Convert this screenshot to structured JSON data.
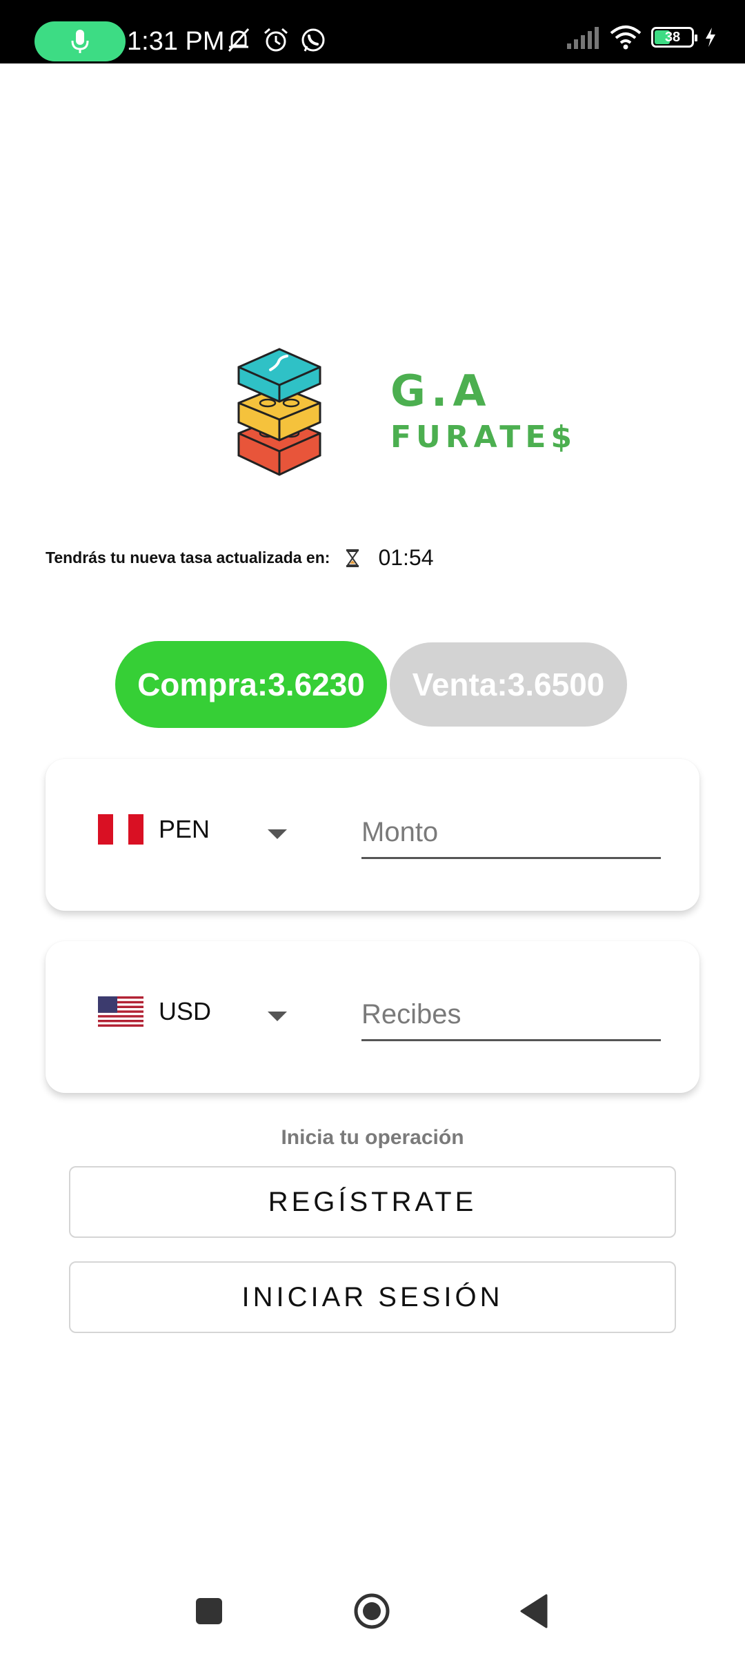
{
  "status_bar": {
    "time": "1:31 PM",
    "battery_level": "38",
    "icons": [
      "mic-icon",
      "mute-icon",
      "alarm-icon",
      "whatsapp-icon",
      "signal-icon",
      "wifi-icon",
      "battery-icon",
      "charging-icon"
    ]
  },
  "brand": {
    "title": "G.A",
    "subtitle": "FURATE$",
    "logo_icon": "stacked-blocks-icon"
  },
  "timer": {
    "label": "Tendrás tu nueva tasa actualizada en:",
    "icon": "hourglass-icon",
    "value": "01:54"
  },
  "rates": {
    "buy_label": "Compra:3.6230",
    "sell_label": "Venta:3.6500",
    "buy_color": "#36cf36",
    "sell_color": "#d3d3d3"
  },
  "from_currency": {
    "code": "PEN",
    "flag": "peru-flag-icon",
    "input_placeholder": "Monto",
    "input_value": ""
  },
  "to_currency": {
    "code": "USD",
    "flag": "usa-flag-icon",
    "input_placeholder": "Recibes",
    "input_value": ""
  },
  "actions": {
    "prompt": "Inicia tu operación",
    "register_label": "REGÍSTRATE",
    "login_label": "INICIAR SESIÓN"
  },
  "accent_color": "#4caf50"
}
